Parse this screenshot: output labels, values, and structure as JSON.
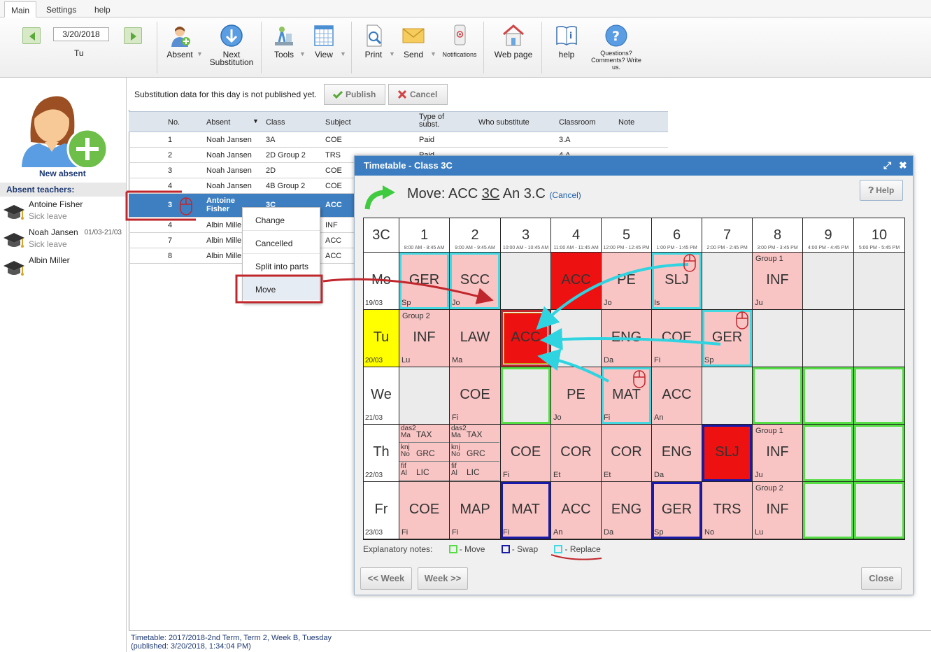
{
  "tabs": [
    "Main",
    "Settings",
    "help"
  ],
  "ribbon": {
    "date": "3/20/2018",
    "day": "Tu",
    "absent": "Absent",
    "next_sub": "Next Substitution",
    "tools": "Tools",
    "view": "View",
    "print": "Print",
    "send": "Send",
    "notifications": "Notifications",
    "webpage": "Web page",
    "help": "help",
    "questions": "Questions? Comments? Write us."
  },
  "sidebar": {
    "new_absent": "New absent",
    "absent_header": "Absent teachers:",
    "teachers": [
      {
        "name": "Antoine Fisher",
        "reason": "Sick leave",
        "dates": ""
      },
      {
        "name": "Noah Jansen",
        "reason": "Sick leave",
        "dates": "01/03-21/03"
      },
      {
        "name": "Albin Miller",
        "reason": "",
        "dates": ""
      }
    ]
  },
  "main": {
    "notice": "Substitution data for this day is not published yet.",
    "publish": "Publish",
    "cancel": "Cancel",
    "headers": {
      "no": "No.",
      "absent": "Absent",
      "class": "Class",
      "subject": "Subject",
      "type": "Type of subst.",
      "who": "Who substitute",
      "room": "Classroom",
      "note": "Note"
    },
    "rows": [
      {
        "no": "1",
        "absent": "Noah Jansen",
        "class": "3A",
        "subject": "COE",
        "type": "Paid",
        "room": "3.A"
      },
      {
        "no": "2",
        "absent": "Noah Jansen",
        "class": "2D Group 2",
        "subject": "TRS",
        "type": "Paid",
        "room": "4.A"
      },
      {
        "no": "3",
        "absent": "Noah Jansen",
        "class": "2D",
        "subject": "COE",
        "type": "",
        "room": ""
      },
      {
        "no": "4",
        "absent": "Noah Jansen",
        "class": "4B Group 2",
        "subject": "COE",
        "type": "",
        "room": ""
      },
      {
        "no": "3",
        "absent": "Antoine Fisher",
        "class": "3C",
        "subject": "ACC",
        "type": "",
        "room": ""
      },
      {
        "no": "4",
        "absent": "Albin Mille",
        "class": "",
        "subject": "INF",
        "type": "",
        "room": ""
      },
      {
        "no": "7",
        "absent": "Albin Mille",
        "class": "",
        "subject": "ACC",
        "type": "",
        "room": ""
      },
      {
        "no": "8",
        "absent": "Albin Mille",
        "class": "",
        "subject": "ACC",
        "type": "",
        "room": ""
      }
    ],
    "footer1": "Timetable: 2017/2018-2nd Term, Term 2, Week B, Tuesday",
    "footer2": "(published: 3/20/2018, 1:34:04 PM)"
  },
  "context_menu": [
    "Change",
    "Cancelled",
    "Split into parts",
    "Move"
  ],
  "dialog": {
    "title": "Timetable - Class 3C",
    "move_prefix": "Move: ACC ",
    "move_class": "3C",
    "move_suffix": " An 3.C ",
    "cancel_link": "(Cancel)",
    "help": "Help",
    "class_label": "3C",
    "periods": [
      {
        "n": "1",
        "t": "8:00 AM - 8:45 AM"
      },
      {
        "n": "2",
        "t": "9:00 AM - 9:45 AM"
      },
      {
        "n": "3",
        "t": "10:00 AM - 10:45 AM"
      },
      {
        "n": "4",
        "t": "11:00 AM - 11:45 AM"
      },
      {
        "n": "5",
        "t": "12:00 PM - 12:45 PM"
      },
      {
        "n": "6",
        "t": "1:00 PM - 1:45 PM"
      },
      {
        "n": "7",
        "t": "2:00 PM - 2:45 PM"
      },
      {
        "n": "8",
        "t": "3:00 PM - 3:45 PM"
      },
      {
        "n": "9",
        "t": "4:00 PM - 4:45 PM"
      },
      {
        "n": "10",
        "t": "5:00 PM - 5:45 PM"
      }
    ],
    "days": [
      {
        "d": "Mo",
        "date": "19/03"
      },
      {
        "d": "Tu",
        "date": "20/03"
      },
      {
        "d": "We",
        "date": "21/03"
      },
      {
        "d": "Th",
        "date": "22/03"
      },
      {
        "d": "Fr",
        "date": "23/03"
      }
    ],
    "cells": [
      [
        {
          "s": "GER",
          "t": "Sp",
          "c": "pink",
          "b": "rp"
        },
        {
          "s": "SCC",
          "t": "Jo",
          "c": "pink",
          "b": "rp"
        },
        {
          "s": "",
          "t": "",
          "c": "",
          "b": ""
        },
        {
          "s": "ACC",
          "t": "",
          "c": "red",
          "b": ""
        },
        {
          "s": "PE",
          "t": "Jo",
          "c": "pink",
          "b": ""
        },
        {
          "s": "SLJ",
          "t": "Is",
          "c": "pink",
          "b": "rp"
        },
        {
          "s": "",
          "t": "",
          "c": "",
          "b": ""
        },
        {
          "s": "INF",
          "t": "Ju",
          "c": "pink",
          "b": "",
          "g": "Group 1"
        },
        {
          "s": "",
          "t": "",
          "c": "",
          "b": ""
        },
        {
          "s": "",
          "t": "",
          "c": "",
          "b": ""
        }
      ],
      [
        {
          "s": "INF",
          "t": "Lu",
          "c": "pink",
          "b": "",
          "g": "Group 2"
        },
        {
          "s": "LAW",
          "t": "Ma",
          "c": "pink",
          "b": ""
        },
        {
          "s": "ACC",
          "t": "",
          "c": "red",
          "b": "cur"
        },
        {
          "s": "",
          "t": "",
          "c": "",
          "b": ""
        },
        {
          "s": "ENG",
          "t": "Da",
          "c": "pink",
          "b": ""
        },
        {
          "s": "COE",
          "t": "Fi",
          "c": "pink",
          "b": ""
        },
        {
          "s": "GER",
          "t": "Sp",
          "c": "pink",
          "b": "rp"
        },
        {
          "s": "",
          "t": "",
          "c": "",
          "b": ""
        },
        {
          "s": "",
          "t": "",
          "c": "",
          "b": ""
        },
        {
          "s": "",
          "t": "",
          "c": "",
          "b": ""
        }
      ],
      [
        {
          "s": "",
          "t": "",
          "c": "",
          "b": ""
        },
        {
          "s": "COE",
          "t": "Fi",
          "c": "pink",
          "b": ""
        },
        {
          "s": "",
          "t": "",
          "c": "",
          "b": "mv"
        },
        {
          "s": "PE",
          "t": "Jo",
          "c": "pink",
          "b": ""
        },
        {
          "s": "MAT",
          "t": "Fi",
          "c": "pink",
          "b": "rp"
        },
        {
          "s": "ACC",
          "t": "An",
          "c": "pink",
          "b": ""
        },
        {
          "s": "",
          "t": "",
          "c": "",
          "b": ""
        },
        {
          "s": "",
          "t": "",
          "c": "",
          "b": "mv"
        },
        {
          "s": "",
          "t": "",
          "c": "",
          "b": "mv"
        },
        {
          "s": "",
          "t": "",
          "c": "",
          "b": "mv"
        }
      ],
      [
        {
          "split": true
        },
        {
          "split": true
        },
        {
          "s": "COE",
          "t": "Fi",
          "c": "pink",
          "b": ""
        },
        {
          "s": "COR",
          "t": "Et",
          "c": "pink",
          "b": ""
        },
        {
          "s": "COR",
          "t": "Et",
          "c": "pink",
          "b": ""
        },
        {
          "s": "ENG",
          "t": "Da",
          "c": "pink",
          "b": ""
        },
        {
          "s": "SLJ",
          "t": "",
          "c": "red",
          "b": "sw"
        },
        {
          "s": "INF",
          "t": "Ju",
          "c": "pink",
          "b": "",
          "g": "Group 1"
        },
        {
          "s": "",
          "t": "",
          "c": "",
          "b": "mv"
        },
        {
          "s": "",
          "t": "",
          "c": "",
          "b": "mv"
        }
      ],
      [
        {
          "s": "COE",
          "t": "Fi",
          "c": "pink",
          "b": ""
        },
        {
          "s": "MAP",
          "t": "Fi",
          "c": "pink",
          "b": ""
        },
        {
          "s": "MAT",
          "t": "Fi",
          "c": "pink",
          "b": "sw"
        },
        {
          "s": "ACC",
          "t": "An",
          "c": "pink",
          "b": ""
        },
        {
          "s": "ENG",
          "t": "Da",
          "c": "pink",
          "b": ""
        },
        {
          "s": "GER",
          "t": "Sp",
          "c": "pink",
          "b": "sw"
        },
        {
          "s": "TRS",
          "t": "No",
          "c": "pink",
          "b": ""
        },
        {
          "s": "INF",
          "t": "Lu",
          "c": "pink",
          "b": "",
          "g": "Group 2"
        },
        {
          "s": "",
          "t": "",
          "c": "",
          "b": "mv"
        },
        {
          "s": "",
          "t": "",
          "c": "",
          "b": "mv"
        }
      ]
    ],
    "split_cells": {
      "c1": [
        {
          "top": "das2",
          "bot": "Ma",
          "s": "TAX"
        },
        {
          "top": "knj",
          "bot": "No",
          "s": "GRC"
        },
        {
          "top": "fif",
          "bot": "Al",
          "s": "LIC"
        }
      ],
      "c2": [
        {
          "top": "das2",
          "bot": "Ma",
          "s": "TAX"
        },
        {
          "top": "knj",
          "bot": "No",
          "s": "GRC"
        },
        {
          "top": "fif",
          "bot": "Al",
          "s": "LIC"
        }
      ]
    },
    "legend_label": "Explanatory notes:",
    "legend_move": "- Move",
    "legend_swap": "- Swap",
    "legend_replace": "- Replace",
    "week_prev": "<< Week",
    "week_next": "Week >>",
    "close": "Close"
  },
  "colors": {
    "accent": "#3b7dc0",
    "pink": "#f8c4c4",
    "red": "#ee1111",
    "move": "#55dd44",
    "swap": "#1a1aaa",
    "replace": "#44d8e0",
    "annotation": "#c0272d"
  }
}
